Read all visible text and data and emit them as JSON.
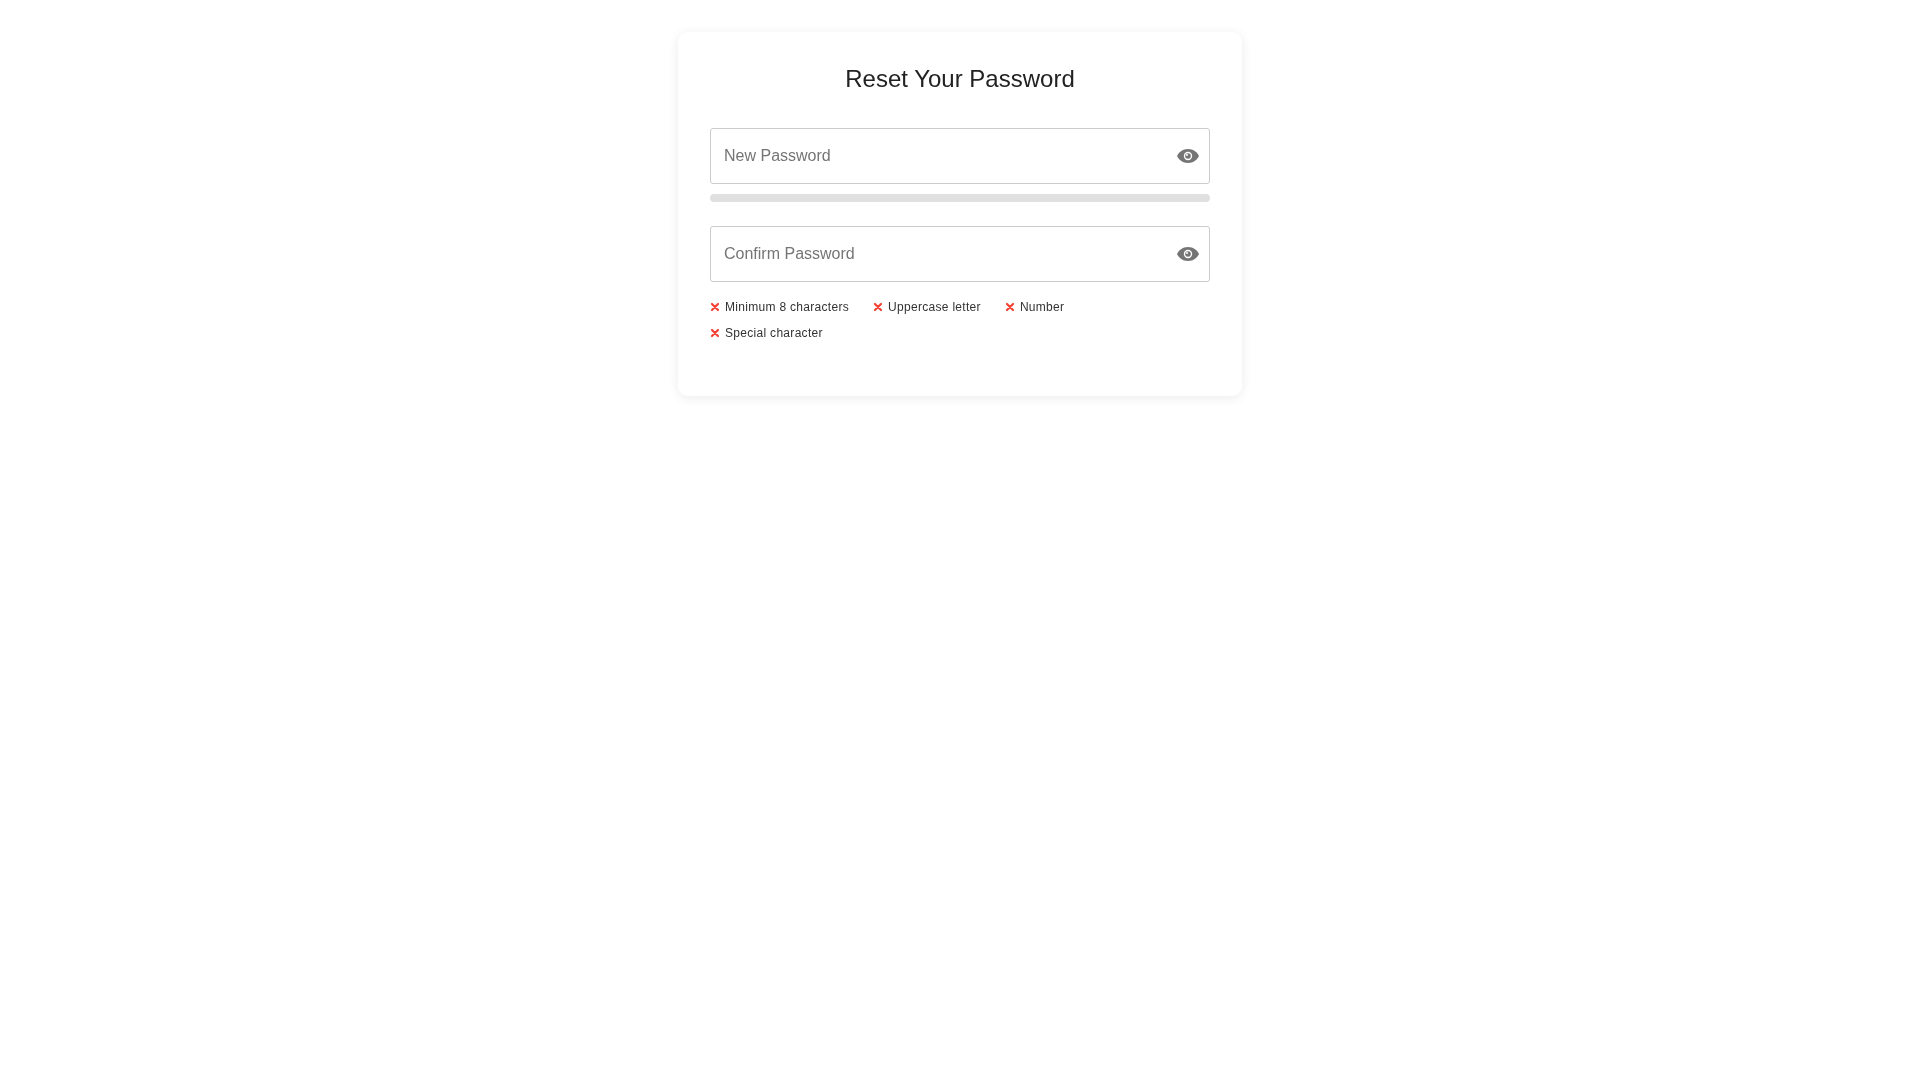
{
  "title": "Reset Your Password",
  "new_password": {
    "placeholder": "New Password"
  },
  "strength": {
    "level": 0
  },
  "confirm_password": {
    "placeholder": "Confirm Password"
  },
  "requirements": [
    {
      "label": "Minimum 8 characters",
      "met": false
    },
    {
      "label": "Uppercase letter",
      "met": false
    },
    {
      "label": "Number",
      "met": false
    },
    {
      "label": "Special character",
      "met": false
    }
  ]
}
